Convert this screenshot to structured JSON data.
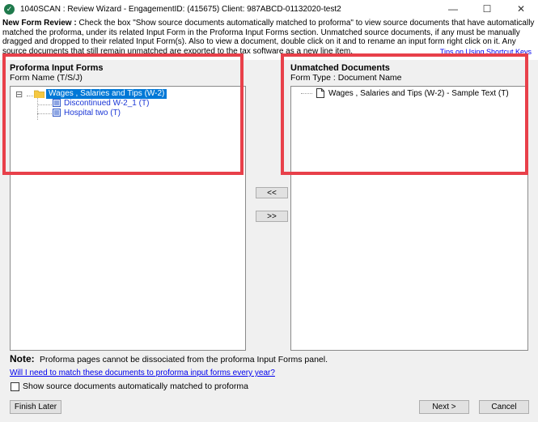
{
  "window": {
    "title": "1040SCAN : Review Wizard - EngagementID: (415675)  Client: 987ABCD-01132020-test2",
    "minimize": "—",
    "maximize": "☐",
    "close": "✕"
  },
  "header": {
    "heading": "New Form Review :",
    "description": "Check the box \"Show source documents automatically matched to proforma\" to view source documents that have automatically matched the proforma, under its related Input Form in the Proforma Input Forms section. Unmatched source documents, if any must be manually dragged and dropped to their related Input Form(s). Also to view a document, double click on it and to rename an input form right click on it. Any source documents that still remain unmatched are exported to the tax software as a new line item.",
    "tips_link": "Tips on Using Shortcut Keys"
  },
  "left_panel": {
    "title": "Proforma Input Forms",
    "subtitle": "Form Name (T/S/J)",
    "tree": {
      "root_toggle": "⊟",
      "root_label": "Wages , Salaries and Tips (W-2)",
      "children": [
        {
          "label": "Discontinued W-2_1 (T)"
        },
        {
          "label": "Hospital two (T)"
        }
      ]
    }
  },
  "right_panel": {
    "title": "Unmatched Documents",
    "subtitle": "Form Type : Document Name",
    "items": [
      {
        "label": "Wages , Salaries and Tips (W-2) - Sample Text (T)"
      }
    ]
  },
  "move_left_button": "<<",
  "move_right_button": ">>",
  "note": {
    "label": "Note:",
    "text": "Proforma pages cannot be dissociated from the proforma Input Forms panel."
  },
  "help_link": "Will I need to match these documents to proforma input forms every year?",
  "show_matched_checkbox": {
    "label": "Show source documents automatically matched to proforma",
    "checked": false
  },
  "footer": {
    "finish_later": "Finish Later",
    "next": "Next >",
    "cancel": "Cancel"
  },
  "colors": {
    "highlight": "#e8404a",
    "link": "#0000ee",
    "selection": "#0078d7"
  }
}
